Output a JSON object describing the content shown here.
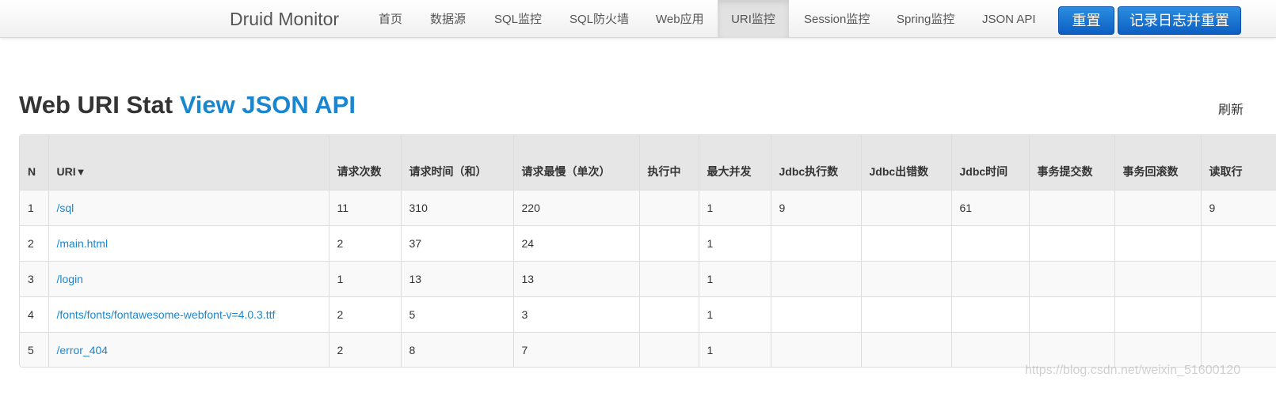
{
  "navbar": {
    "brand": "Druid Monitor",
    "items": [
      {
        "label": "首页",
        "active": false
      },
      {
        "label": "数据源",
        "active": false
      },
      {
        "label": "SQL监控",
        "active": false
      },
      {
        "label": "SQL防火墙",
        "active": false
      },
      {
        "label": "Web应用",
        "active": false
      },
      {
        "label": "URI监控",
        "active": true
      },
      {
        "label": "Session监控",
        "active": false
      },
      {
        "label": "Spring监控",
        "active": false
      },
      {
        "label": "JSON API",
        "active": false
      }
    ],
    "reset_button": "重置",
    "log_reset_button": "记录日志并重置"
  },
  "heading": {
    "title": "Web URI Stat",
    "json_link": "View JSON API",
    "refresh_text": "刷新"
  },
  "table": {
    "columns": [
      "N",
      "URI",
      "请求次数",
      "请求时间（和）",
      "请求最慢（单次）",
      "执行中",
      "最大并发",
      "Jdbc执行数",
      "Jdbc出错数",
      "Jdbc时间",
      "事务提交数",
      "事务回滚数",
      "读取行"
    ],
    "sort_indicator": "▼",
    "rows": [
      [
        "1",
        "/sql",
        "11",
        "310",
        "220",
        "",
        "1",
        "9",
        "",
        "61",
        "",
        "",
        "9"
      ],
      [
        "2",
        "/main.html",
        "2",
        "37",
        "24",
        "",
        "1",
        "",
        "",
        "",
        "",
        "",
        ""
      ],
      [
        "3",
        "/login",
        "1",
        "13",
        "13",
        "",
        "1",
        "",
        "",
        "",
        "",
        "",
        ""
      ],
      [
        "4",
        "/fonts/fonts/fontawesome-webfont-v=4.0.3.ttf",
        "2",
        "5",
        "3",
        "",
        "1",
        "",
        "",
        "",
        "",
        "",
        ""
      ],
      [
        "5",
        "/error_404",
        "2",
        "8",
        "7",
        "",
        "1",
        "",
        "",
        "",
        "",
        "",
        ""
      ]
    ]
  },
  "watermark": "https://blog.csdn.net/weixin_51600120",
  "colors": {
    "link": "#1a86d0",
    "button": "#0d5fc2",
    "header_bg": "#e6e6e6",
    "active_nav_bg": "#e2e2e2"
  }
}
